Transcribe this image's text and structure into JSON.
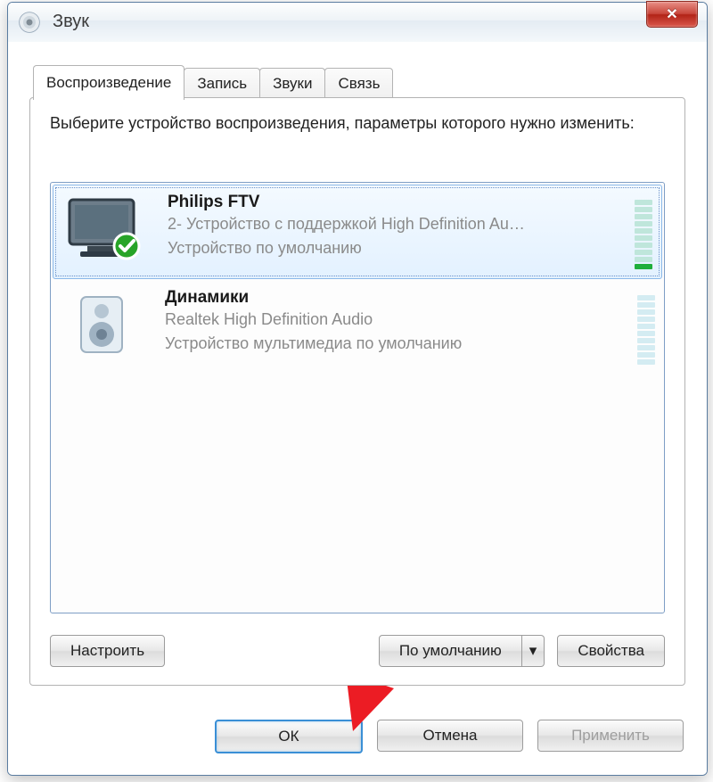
{
  "window": {
    "title": "Звук"
  },
  "tabs": [
    {
      "label": "Воспроизведение",
      "active": true
    },
    {
      "label": "Запись",
      "active": false
    },
    {
      "label": "Звуки",
      "active": false
    },
    {
      "label": "Связь",
      "active": false
    }
  ],
  "instruction": "Выберите устройство воспроизведения, параметры которого нужно изменить:",
  "devices": [
    {
      "name": "Philips FTV",
      "line1": "2- Устройство с поддержкой High Definition Au…",
      "status": "Устройство по умолчанию",
      "selected": true,
      "default_badge": true,
      "meter_active": true,
      "meter_on_segments": 1
    },
    {
      "name": "Динамики",
      "line1": "Realtek High Definition Audio",
      "status": "Устройство мультимедиа по умолчанию",
      "selected": false,
      "default_badge": false,
      "meter_active": false,
      "meter_on_segments": 0
    }
  ],
  "buttons": {
    "configure": "Настроить",
    "set_default": "По умолчанию",
    "dropdown_glyph": "▾",
    "properties": "Свойства",
    "ok": "ОК",
    "cancel": "Отмена",
    "apply": "Применить"
  }
}
